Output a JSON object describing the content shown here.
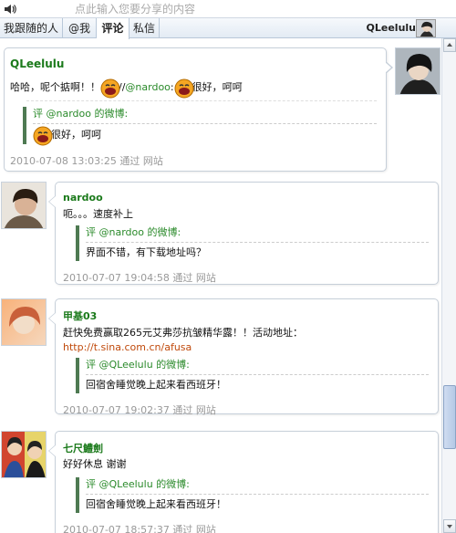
{
  "compose": {
    "placeholder": "点此输入您要分享的内容"
  },
  "tabs": [
    {
      "label": "我跟随的人"
    },
    {
      "label": "@我"
    },
    {
      "label": "评论"
    },
    {
      "label": "私信"
    }
  ],
  "current_user": {
    "name": "QLeelulu"
  },
  "posts": [
    {
      "author": "QLeelulu",
      "text_before": "哈哈，呢个掂啊！！",
      "text_sep": "//",
      "mention": "@nardoo",
      "text_mid": ":",
      "text_after": "很好，呵呵",
      "quote_prefix": "评",
      "quote_mention": "@nardoo",
      "quote_suffix": "的微博:",
      "quote_text": "很好，呵呵",
      "time": "2010-07-08 13:03:25",
      "via": "通过 网站"
    },
    {
      "author": "nardoo",
      "text": "呃。。。速度补上",
      "quote_prefix": "评",
      "quote_mention": "@nardoo",
      "quote_suffix": "的微博:",
      "quote_text": "界面不错，有下载地址吗？",
      "time": "2010-07-07 19:04:58",
      "via": "通过 网站"
    },
    {
      "author": "甲基03",
      "text": "赶快免费赢取265元艾弗莎抗皱精华露！！活动地址：",
      "link": "http://t.sina.com.cn/afusa",
      "quote_prefix": "评",
      "quote_mention": "@QLeelulu",
      "quote_suffix": "的微博:",
      "quote_text": "回宿舍睡觉晚上起来看西班牙！",
      "time": "2010-07-07 19:02:37",
      "via": "通过 网站"
    },
    {
      "author": "七尺鱧劍",
      "text": "好好休息 谢谢",
      "quote_prefix": "评",
      "quote_mention": "@QLeelulu",
      "quote_suffix": "的微博:",
      "quote_text": "回宿舍睡觉晚上起来看西班牙！",
      "time": "2010-07-07 18:57:37",
      "via": "通过 网站"
    }
  ],
  "icons": {
    "speaker": "speaker-icon",
    "emoji": "laughing-emoticon-icon"
  },
  "colors": {
    "author": "#1b7a1b",
    "mention": "#2a8a2a",
    "link": "#c04a0c",
    "quote_bar": "#4e7a52",
    "meta": "#999999"
  }
}
